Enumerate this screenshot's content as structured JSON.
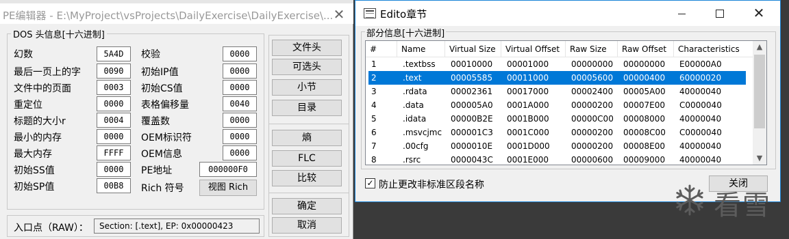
{
  "pe_window": {
    "title": "PE编辑器 - E:\\MyProject\\vsProjects\\DailyExercise\\DailyExercise\\...",
    "close_symbol": "✕",
    "dos_group_title": "DOS 头信息[十六进制]",
    "fields_left": [
      {
        "label": "幻数",
        "value": "5A4D"
      },
      {
        "label": "最后一页上的字",
        "value": "0090"
      },
      {
        "label": "文件中的页面",
        "value": "0003"
      },
      {
        "label": "重定位",
        "value": "0000"
      },
      {
        "label": "标题的大小r",
        "value": "0004"
      },
      {
        "label": "最小的内存",
        "value": "0000"
      },
      {
        "label": "最大内存",
        "value": "FFFF"
      },
      {
        "label": "初始SS值",
        "value": "0000"
      },
      {
        "label": "初始SP值",
        "value": "00B8"
      }
    ],
    "fields_right": [
      {
        "label": "校验",
        "value": "0000"
      },
      {
        "label": "初始IP值",
        "value": "0000"
      },
      {
        "label": "初始CS值",
        "value": "0000"
      },
      {
        "label": "表格偏移量",
        "value": "0040"
      },
      {
        "label": "覆盖数",
        "value": "0000"
      },
      {
        "label": "OEM标识符",
        "value": "0000"
      },
      {
        "label": "OEM信息",
        "value": "0000"
      },
      {
        "label": "PE地址",
        "value": "000000F0"
      },
      {
        "label": "Rich 符号",
        "value": ""
      }
    ],
    "rich_button": "视图 Rich",
    "side_buttons": [
      "文件头",
      "可选头",
      "小节",
      "目录",
      "熵",
      "FLC",
      "比较",
      "确定",
      "取消"
    ],
    "entry_label": "入口点（RAW）：",
    "entry_value": "Section: [.text], EP: 0x00000423"
  },
  "section_window": {
    "title": "Edito章节",
    "close_symbol": "✕",
    "group_title": "部分信息[十六进制]",
    "columns": [
      "#",
      "Name",
      "Virtual Size",
      "Virtual Offset",
      "Raw Size",
      "Raw Offset",
      "Characteristics"
    ],
    "rows": [
      [
        "1",
        ".textbss",
        "00010000",
        "00001000",
        "00000000",
        "00000000",
        "E00000A0"
      ],
      [
        "2",
        ".text",
        "00005585",
        "00011000",
        "00005600",
        "00000400",
        "60000020"
      ],
      [
        "3",
        ".rdata",
        "00002361",
        "00017000",
        "00002400",
        "00005A00",
        "40000040"
      ],
      [
        "4",
        ".data",
        "000005A0",
        "0001A000",
        "00000200",
        "00007E00",
        "C0000040"
      ],
      [
        "5",
        ".idata",
        "00000B2E",
        "0001B000",
        "00000C00",
        "00008000",
        "40000040"
      ],
      [
        "6",
        ".msvcjmc",
        "000001C3",
        "0001C000",
        "00000200",
        "00008C00",
        "C0000040"
      ],
      [
        "7",
        ".00cfg",
        "0000010E",
        "0001D000",
        "00000200",
        "00008E00",
        "40000040"
      ],
      [
        "8",
        ".rsrc",
        "0000043C",
        "0001E000",
        "00000600",
        "00009000",
        "40000040"
      ]
    ],
    "selected_row": 2,
    "checkbox_label": "防止更改非标准区段名称",
    "checkbox_checked": true,
    "checkbox_mark": "✓",
    "close_button": "关闭",
    "scroll_up": "▲",
    "scroll_down": "▼"
  },
  "watermark": {
    "text": "看雪",
    "icon": "snowflake-icon"
  }
}
